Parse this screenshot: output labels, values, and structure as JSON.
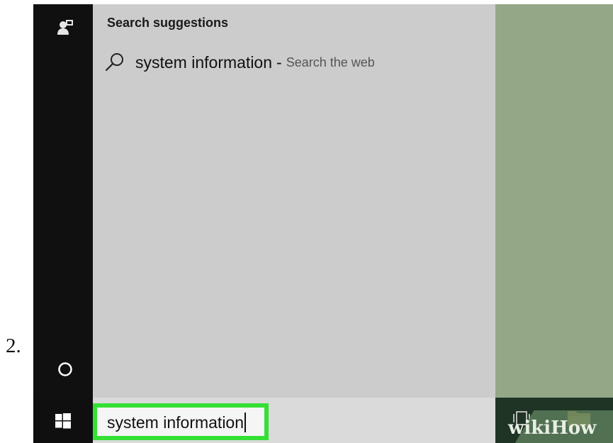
{
  "step": {
    "number": "2."
  },
  "search_panel": {
    "heading": "Search suggestions",
    "suggestion": {
      "query": "system information",
      "separator": "-",
      "action": "Search the web",
      "icon": "search-icon"
    }
  },
  "taskbar": {
    "search_value": "system information",
    "start_icon": "windows-icon",
    "task_view_icon": "task-view-icon",
    "file_explorer_icon": "folder-icon"
  },
  "rail": {
    "user_icon": "user-icon",
    "cortana_icon": "cortana-circle-icon"
  },
  "colors": {
    "highlight": "#35e035",
    "panel": "#cccccc",
    "rail": "#101010",
    "desktop": "#94a888"
  },
  "watermark": {
    "text": "wikiHow"
  }
}
